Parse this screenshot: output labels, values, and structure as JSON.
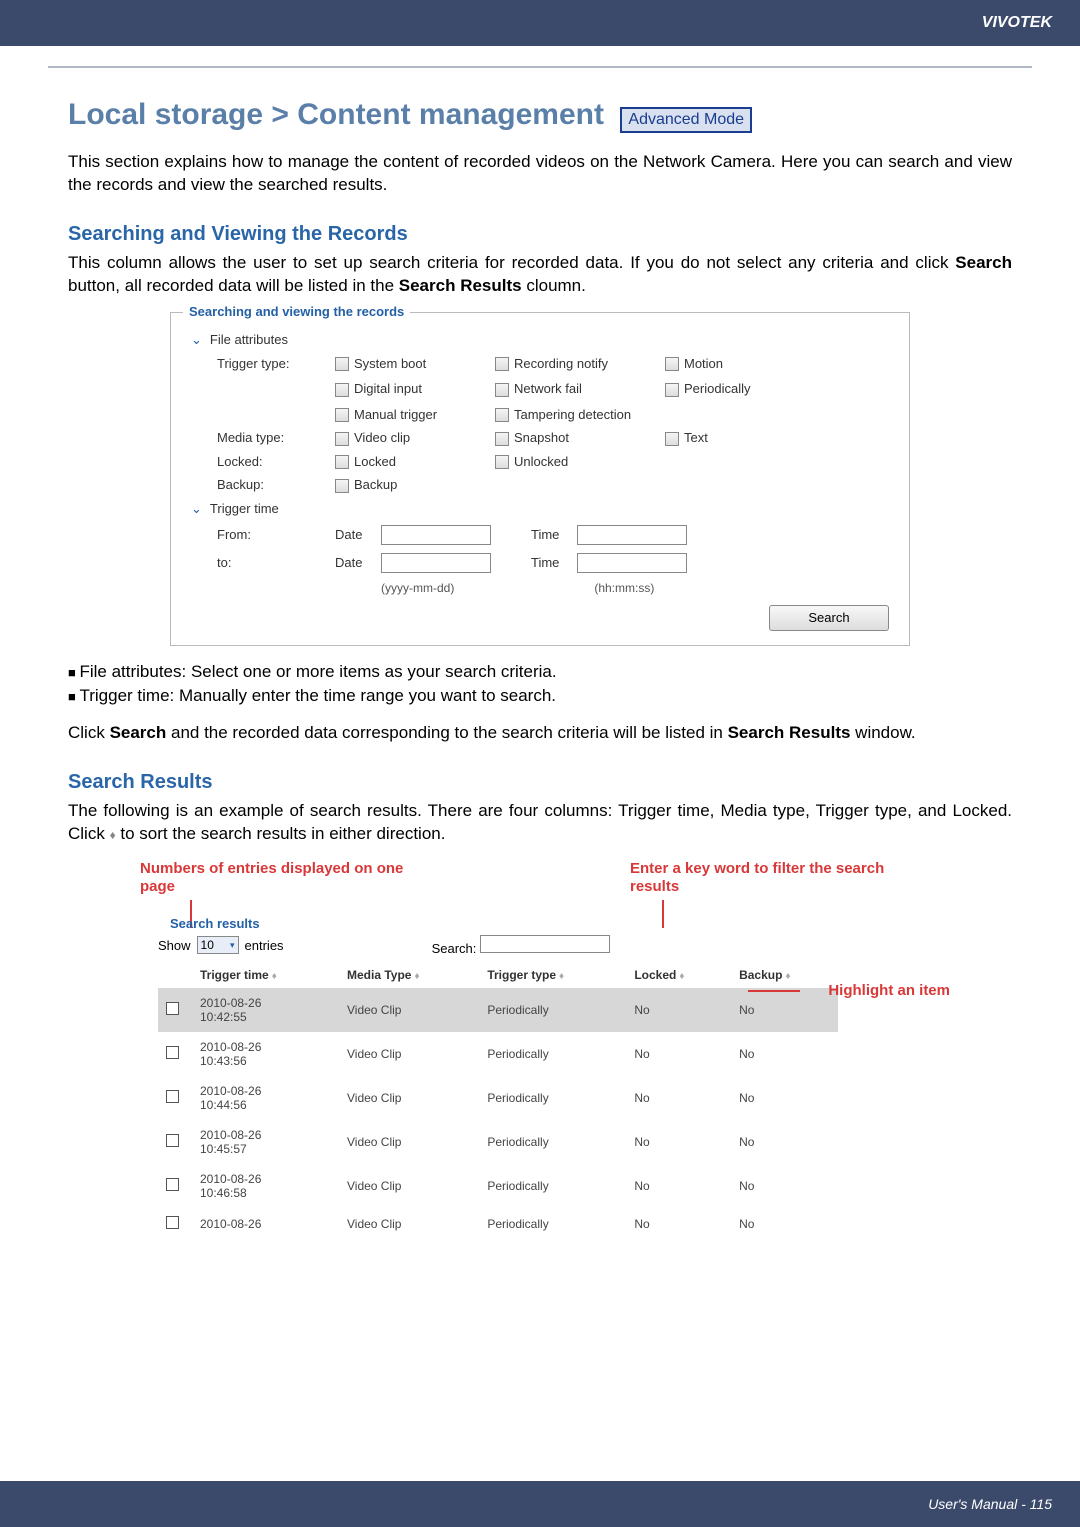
{
  "header": {
    "brand": "VIVOTEK"
  },
  "title": "Local storage > Content management",
  "mode_badge": "Advanced Mode",
  "intro": "This section explains how to manage the content of recorded videos on the Network Camera. Here you can search and view the records and view the searched results.",
  "section1": {
    "heading": "Searching and Viewing the Records",
    "text_a": "This column allows the user to set up search criteria for recorded data. If you do not select any criteria and click ",
    "text_b": "Search",
    "text_c": " button, all recorded data will be listed in the ",
    "text_d": "Search Results",
    "text_e": " cloumn."
  },
  "search_panel": {
    "title": "Searching and viewing the records",
    "file_attributes": "File attributes",
    "trigger_type_label": "Trigger type:",
    "opts_col1": [
      "System boot",
      "Digital input",
      "Manual trigger"
    ],
    "opts_col2": [
      "Recording notify",
      "Network fail",
      "Tampering detection"
    ],
    "opts_col3": [
      "Motion",
      "Periodically"
    ],
    "media_type_label": "Media type:",
    "media_opts": [
      "Video clip",
      "Snapshot",
      "Text"
    ],
    "locked_label": "Locked:",
    "locked_opts": [
      "Locked",
      "Unlocked"
    ],
    "backup_label": "Backup:",
    "backup_opt": "Backup",
    "trigger_time": "Trigger time",
    "from": "From:",
    "to": "to:",
    "date": "Date",
    "time": "Time",
    "date_fmt": "(yyyy-mm-dd)",
    "time_fmt": "(hh:mm:ss)",
    "search_btn": "Search"
  },
  "bullets": {
    "b1": "File attributes: Select one or more items as your search criteria.",
    "b2": "Trigger time: Manually enter the time range you want to search."
  },
  "click_text": {
    "a": "Click ",
    "b": "Search",
    "c": " and the recorded data corresponding to the search criteria will be listed in ",
    "d": "Search Results",
    "e": " window."
  },
  "section2": {
    "heading": "Search Results",
    "text_a": "The following is an example of search results. There are four columns: Trigger time, Media type, Trigger type, and Locked. Click ",
    "text_b": " to sort the search results in either direction."
  },
  "callouts": {
    "entries": "Numbers of entries displayed on one page",
    "filter": "Enter a key word to filter the search results",
    "highlight": "Highlight an item"
  },
  "results": {
    "title": "Search results",
    "show": "Show",
    "show_val": "10",
    "entries": "entries",
    "search_label": "Search:",
    "headers": [
      "Trigger time",
      "Media Type",
      "Trigger type",
      "Locked",
      "Backup"
    ],
    "rows": [
      {
        "selected": true,
        "time": "2010-08-26 10:42:55",
        "media": "Video Clip",
        "trigger": "Periodically",
        "locked": "No",
        "backup": "No"
      },
      {
        "selected": false,
        "time": "2010-08-26 10:43:56",
        "media": "Video Clip",
        "trigger": "Periodically",
        "locked": "No",
        "backup": "No"
      },
      {
        "selected": false,
        "time": "2010-08-26 10:44:56",
        "media": "Video Clip",
        "trigger": "Periodically",
        "locked": "No",
        "backup": "No"
      },
      {
        "selected": false,
        "time": "2010-08-26 10:45:57",
        "media": "Video Clip",
        "trigger": "Periodically",
        "locked": "No",
        "backup": "No"
      },
      {
        "selected": false,
        "time": "2010-08-26 10:46:58",
        "media": "Video Clip",
        "trigger": "Periodically",
        "locked": "No",
        "backup": "No"
      },
      {
        "selected": false,
        "time": "2010-08-26",
        "media": "Video Clip",
        "trigger": "Periodically",
        "locked": "No",
        "backup": "No"
      }
    ]
  },
  "footer": {
    "text": "User's Manual - 115"
  }
}
